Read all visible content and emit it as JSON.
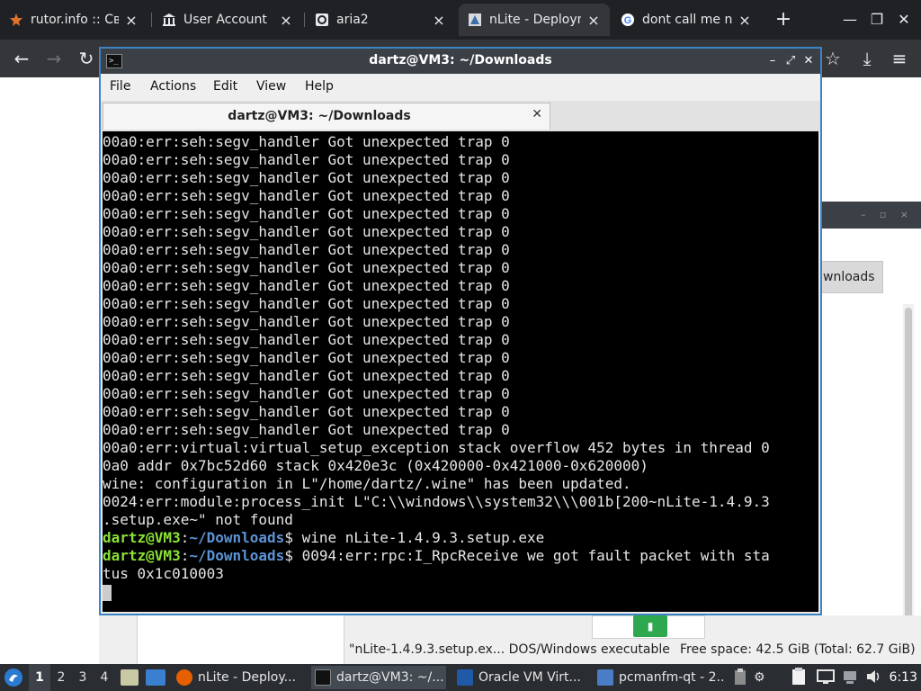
{
  "browser": {
    "tabs": [
      {
        "label": "rutor.info :: Своб",
        "icon": "rutor-icon"
      },
      {
        "label": "User Account",
        "icon": "bank-icon"
      },
      {
        "label": "aria2",
        "icon": "aria2-icon"
      },
      {
        "label": "nLite - Deployme",
        "icon": "nlite-icon",
        "active": true
      },
      {
        "label": "dont call me nez",
        "icon": "google-icon"
      }
    ],
    "new_tab": "+",
    "window_controls": {
      "minimize": "—",
      "maximize": "❐",
      "close": "✕"
    },
    "nav": {
      "back": "←",
      "forward": "→",
      "reload": "↻",
      "star": "☆",
      "download": "⤓",
      "menu": "≡"
    }
  },
  "file_manager": {
    "tab_label": "wnloads",
    "status_file": "\"nLite-1.4.9.3.setup.ex... DOS/Windows executable",
    "status_space": "Free space: 42.5 GiB (Total: 62.7 GiB)"
  },
  "terminal": {
    "title": "dartz@VM3: ~/Downloads",
    "title_buttons": {
      "minimize": "–",
      "restore": "⤢",
      "close": "✕"
    },
    "menu": [
      "File",
      "Actions",
      "Edit",
      "View",
      "Help"
    ],
    "tab_label": "dartz@VM3: ~/Downloads",
    "tab_close": "✕",
    "prompt_user": "dartz@VM3",
    "prompt_path": "~/Downloads",
    "lines": [
      "00a0:err:seh:segv_handler Got unexpected trap 0",
      "00a0:err:seh:segv_handler Got unexpected trap 0",
      "00a0:err:seh:segv_handler Got unexpected trap 0",
      "00a0:err:seh:segv_handler Got unexpected trap 0",
      "00a0:err:seh:segv_handler Got unexpected trap 0",
      "00a0:err:seh:segv_handler Got unexpected trap 0",
      "00a0:err:seh:segv_handler Got unexpected trap 0",
      "00a0:err:seh:segv_handler Got unexpected trap 0",
      "00a0:err:seh:segv_handler Got unexpected trap 0",
      "00a0:err:seh:segv_handler Got unexpected trap 0",
      "00a0:err:seh:segv_handler Got unexpected trap 0",
      "00a0:err:seh:segv_handler Got unexpected trap 0",
      "00a0:err:seh:segv_handler Got unexpected trap 0",
      "00a0:err:seh:segv_handler Got unexpected trap 0",
      "00a0:err:seh:segv_handler Got unexpected trap 0",
      "00a0:err:seh:segv_handler Got unexpected trap 0",
      "00a0:err:seh:segv_handler Got unexpected trap 0",
      "00a0:err:virtual:virtual_setup_exception stack overflow 452 bytes in thread 0",
      "0a0 addr 0x7bc52d60 stack 0x420e3c (0x420000-0x421000-0x620000)",
      "wine: configuration in L\"/home/dartz/.wine\" has been updated.",
      "0024:err:module:process_init L\"C:\\\\windows\\\\system32\\\\\\001b[200~nLite-1.4.9.3",
      ".setup.exe~\" not found"
    ],
    "cmd1": "$ wine nLite-1.4.9.3.setup.exe",
    "cmd2": "$ 0094:err:rpc:I_RpcReceive we got fault packet with sta",
    "cmd2_cont": "tus 0x1c010003"
  },
  "taskbar": {
    "workspaces": [
      "1",
      "2",
      "3",
      "4"
    ],
    "tasks": [
      {
        "label": "nLite - Deploy...",
        "icon": "firefox-icon"
      },
      {
        "label": "dartz@VM3: ~/...",
        "icon": "terminal-icon",
        "active": true
      },
      {
        "label": "Oracle VM Virt...",
        "icon": "virtualbox-icon"
      },
      {
        "label": "pcmanfm-qt - 2...",
        "icon": "folder-icon"
      }
    ],
    "clock": "6:13"
  },
  "colors": {
    "terminal_bg": "#000000",
    "prompt_user": "#8ae234",
    "prompt_path": "#5c93d6",
    "window_border": "#3c83c4"
  }
}
